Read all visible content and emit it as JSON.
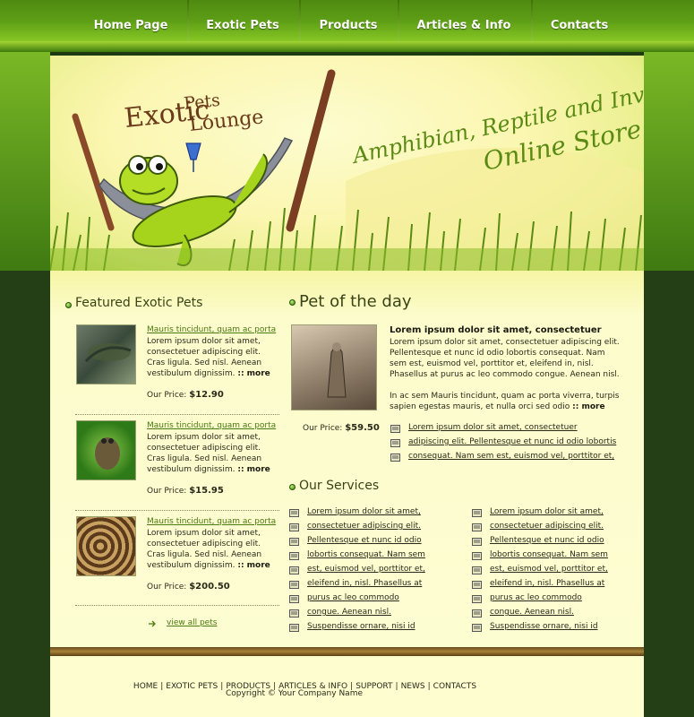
{
  "nav": {
    "items": [
      {
        "label": "Home Page"
      },
      {
        "label": "Exotic Pets"
      },
      {
        "label": "Products"
      },
      {
        "label": "Articles & Info"
      },
      {
        "label": "Contacts"
      }
    ]
  },
  "header": {
    "logo_line1": "Exotic",
    "logo_line2": "Pets",
    "logo_line3": "Lounge",
    "tagline_line1": "Amphibian, Reptile and Invert",
    "tagline_line2": "Online Store"
  },
  "featured": {
    "title": "Featured Exotic Pets",
    "pets": [
      {
        "link": "Mauris tincidunt, quam ac porta",
        "desc": "Lorem ipsum dolor sit amet, consectetuer adipiscing elit. Cras ligula. Sed nisl. Aenean vestibulum dignissim.",
        "more": ":: more",
        "price_label": "Our Price:",
        "price": "$12.90"
      },
      {
        "link": "Mauris tincidunt, quam ac porta",
        "desc": "Lorem ipsum dolor sit amet, consectetuer adipiscing elit. Cras ligula. Sed nisl. Aenean vestibulum dignissim.",
        "more": ":: more",
        "price_label": "Our Price:",
        "price": "$15.95"
      },
      {
        "link": "Mauris tincidunt, quam ac porta",
        "desc": "Lorem ipsum dolor sit amet, consectetuer adipiscing elit. Cras ligula. Sed nisl. Aenean vestibulum dignissim.",
        "more": ":: more",
        "price_label": "Our Price:",
        "price": "$200.50"
      }
    ],
    "view_all": "view all pets"
  },
  "pet_of_day": {
    "title": "Pet of the day",
    "heading": "Lorem ipsum dolor sit amet, consectetuer",
    "para1": "Lorem ipsum dolor sit amet, consectetuer adipiscing elit. Pellentesque et nunc id odio lobortis consequat. Nam sem est, euismod vel, porttitor et, eleifend in, nisl. Phasellus at purus ac leo commodo congue. Aenean nisl.",
    "para2": "In ac sem Mauris tincidunt, quam ac porta viverra, turpis sapien egestas mauris, et nulla orci sed odio",
    "more": ":: more",
    "price_label": "Our Price:",
    "price": "$59.50",
    "links": [
      "Lorem ipsum dolor sit amet, consectetuer",
      "adipiscing elit. Pellentesque et nunc id odio lobortis",
      "consequat. Nam sem est, euismod vel, porttitor et,"
    ]
  },
  "services": {
    "title": "Our Services",
    "col1": [
      "Lorem ipsum dolor sit amet,",
      "consectetuer adipiscing elit.",
      "Pellentesque et nunc id odio",
      "lobortis consequat. Nam sem",
      "est, euismod vel, porttitor et,",
      "eleifend in, nisl. Phasellus at",
      "purus ac leo commodo",
      "congue. Aenean nisl.",
      "Suspendisse ornare, nisi id"
    ],
    "col2": [
      "Lorem ipsum dolor sit amet,",
      "consectetuer adipiscing elit.",
      "Pellentesque et nunc id odio",
      "lobortis consequat. Nam sem",
      "est, euismod vel, porttitor et,",
      "eleifend in, nisl. Phasellus at",
      "purus ac leo commodo",
      "congue. Aenean nisl.",
      "Suspendisse ornare, nisi id"
    ]
  },
  "footer": {
    "links": [
      "HOME",
      "EXOTIC PETS",
      "PRODUCTS",
      "ARTICLES & INFO",
      "SUPPORT",
      "NEWS",
      "CONTACTS"
    ],
    "copyright": "Copyright © Your Company Name"
  },
  "colors": {
    "nav_green": "#5e9e16",
    "cream": "#fdfdd2",
    "dark_green": "#243f16",
    "link_green": "#4a7a10"
  }
}
